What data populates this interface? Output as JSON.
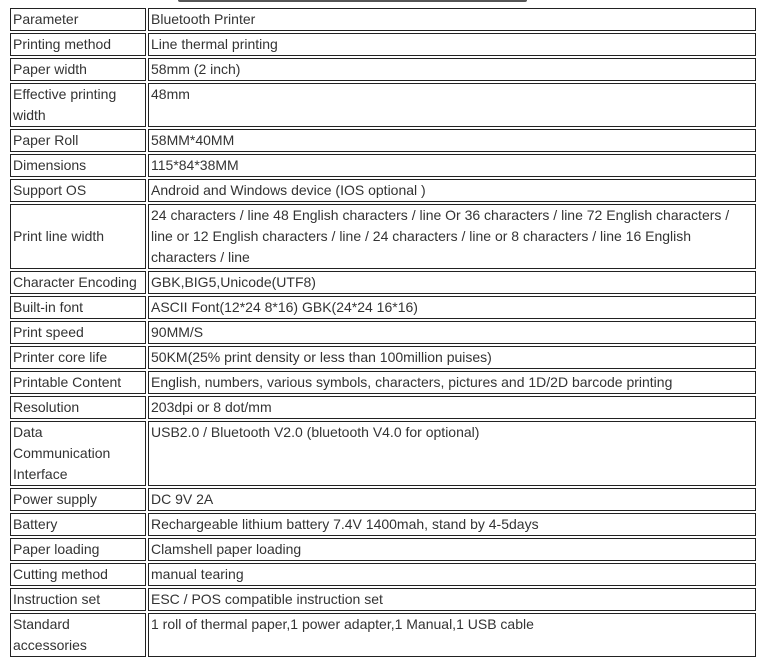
{
  "rows": [
    {
      "key": "Parameter",
      "value": "Bluetooth Printer"
    },
    {
      "key": "Printing method",
      "value": "Line thermal printing"
    },
    {
      "key": "Paper width",
      "value": "58mm (2 inch)"
    },
    {
      "key": "Effective printing width",
      "value": "48mm"
    },
    {
      "key": "Paper Roll",
      "value": "58MM*40MM"
    },
    {
      "key": "Dimensions",
      "value": "115*84*38MM"
    },
    {
      "key": "Support OS",
      "value": "Android and Windows device (IOS optional )"
    },
    {
      "key": "Print line width",
      "value": "24 characters / line  48 English characters / line Or  36 characters / line 72 English characters / line or  12 English characters / line  / 24 characters / line  or   8 characters / line   16 English characters / line"
    },
    {
      "key": "Character Encoding",
      "value": "GBK,BIG5,Unicode(UTF8)"
    },
    {
      "key": "Built-in font",
      "value": "ASCII Font(12*24 8*16) GBK(24*24 16*16)"
    },
    {
      "key": "Print speed",
      "value": "90MM/S"
    },
    {
      "key": "Printer core life",
      "value": "50KM(25% print density or less than 100million puises)"
    },
    {
      "key": "Printable Content",
      "value": "English, numbers, various symbols, characters, pictures and 1D/2D barcode printing"
    },
    {
      "key": "Resolution",
      "value": "203dpi or 8 dot/mm"
    },
    {
      "key": "Data Communication Interface",
      "value": "USB2.0 / Bluetooth V2.0 (bluetooth V4.0 for optional)"
    },
    {
      "key": "Power supply",
      "value": "DC 9V 2A"
    },
    {
      "key": "Battery",
      "value": "Rechargeable lithium battery 7.4V 1400mah, stand by 4-5days"
    },
    {
      "key": "Paper loading",
      "value": "Clamshell paper loading"
    },
    {
      "key": "Cutting method",
      "value": "manual tearing"
    },
    {
      "key": "Instruction set",
      "value": "ESC / POS compatible instruction set"
    },
    {
      "key": "Standard accessories",
      "value": "1 roll of thermal paper,1 power adapter,1 Manual,1 USB cable"
    }
  ]
}
